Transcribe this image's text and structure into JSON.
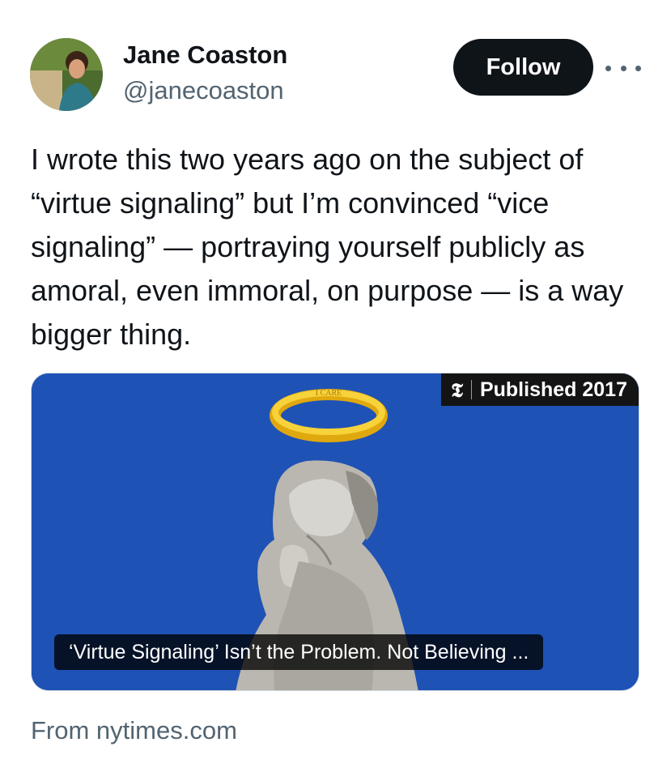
{
  "author": {
    "name": "Jane Coaston",
    "handle": "@janecoaston"
  },
  "actions": {
    "follow_label": "Follow",
    "more_icon": "more-horizontal-icon"
  },
  "tweet": {
    "text": "I wrote this two years ago on the subject of “virtue signaling” but I’m convinced “vice signaling” — portraying yourself publicly as amoral, even immoral, on purpose — is a way bigger thing."
  },
  "link_card": {
    "publisher_logo": "𝕿",
    "badge_text": "Published 2017",
    "title": "‘Virtue Signaling’ Isn’t the Problem. Not Believing ...",
    "halo_text": "I CARE",
    "background_color": "#1f52b5",
    "halo_color": "#f2c21b"
  },
  "source": {
    "label": "From nytimes.com"
  }
}
